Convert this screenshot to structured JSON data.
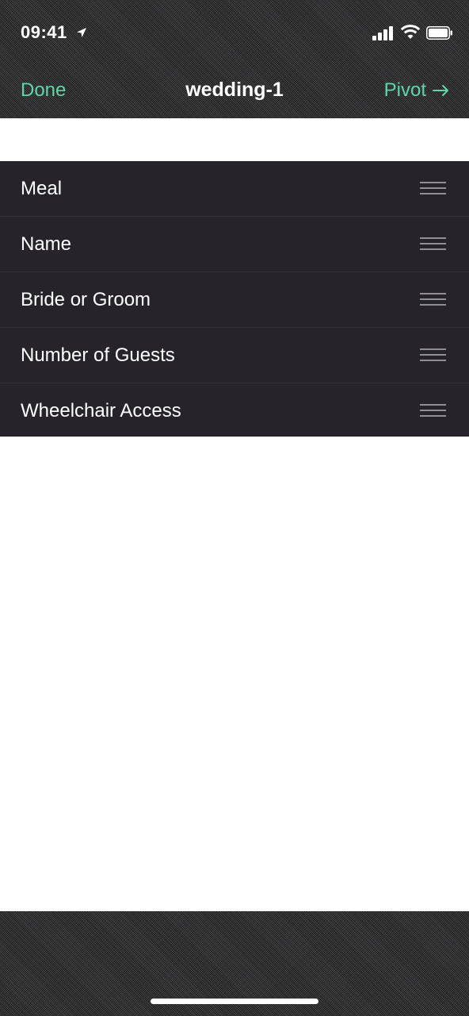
{
  "status_bar": {
    "time": "09:41",
    "icons": [
      "location-arrow-icon",
      "signal-icon",
      "wifi-icon",
      "battery-icon"
    ]
  },
  "nav": {
    "left_label": "Done",
    "title": "wedding-1",
    "right_label": "Pivot",
    "right_icon": "arrow-right-icon"
  },
  "fields": [
    {
      "label": "Meal"
    },
    {
      "label": "Name"
    },
    {
      "label": "Bride or Groom"
    },
    {
      "label": "Number of Guests"
    },
    {
      "label": "Wheelchair Access"
    }
  ],
  "colors": {
    "accent": "#5fd6a8",
    "list_background": "#26242a",
    "header_background": "#3a3a3c",
    "page_background": "#ffffff"
  }
}
